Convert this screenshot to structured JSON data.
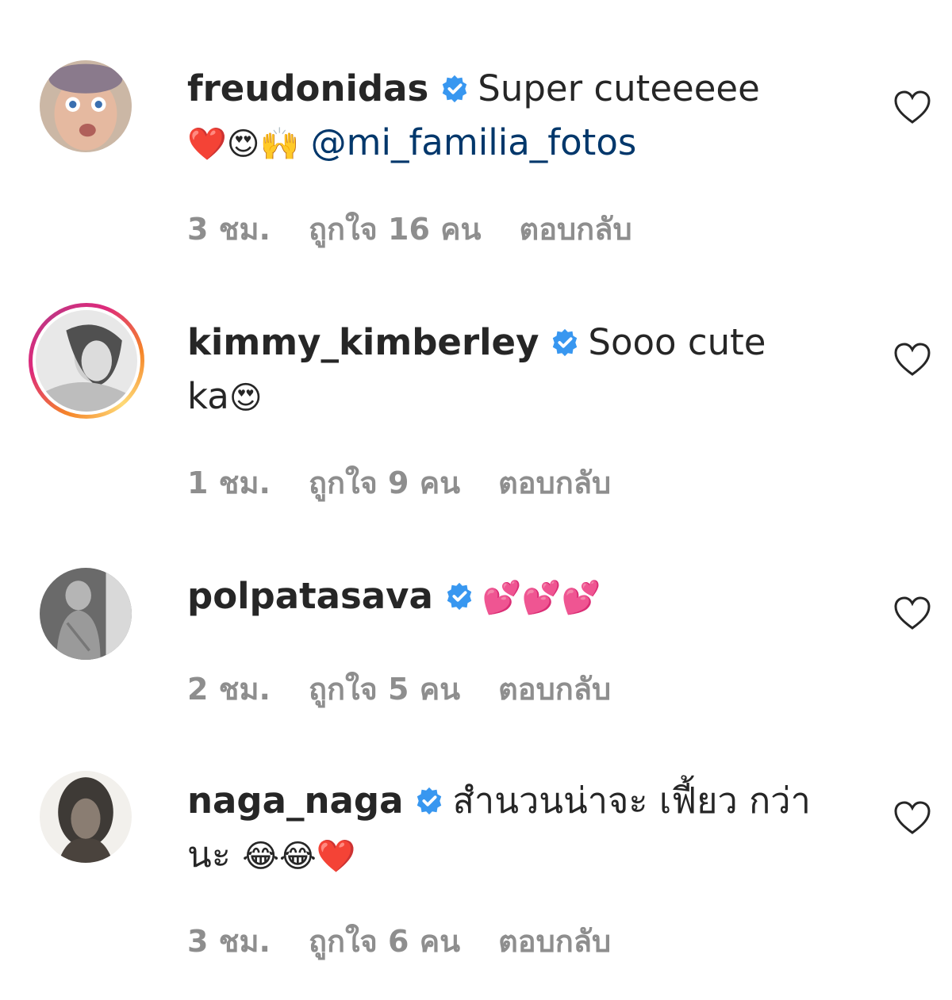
{
  "comments": [
    {
      "username": "freudonidas",
      "text": "Super cuteeeee",
      "emojis": "❤️😍🙌",
      "mention": "@mi_familia_fotos",
      "time": "3 ชม.",
      "likes": "ถูกใจ 16 คน",
      "reply": "ตอบกลับ"
    },
    {
      "username": "kimmy_kimberley",
      "text": "Sooo cute",
      "text2": "ka",
      "emojis": "😍",
      "time": "1 ชม.",
      "likes": "ถูกใจ 9 คน",
      "reply": "ตอบกลับ"
    },
    {
      "username": "polpatasava",
      "emojis": "💕💕💕",
      "time": "2 ชม.",
      "likes": "ถูกใจ 5 คน",
      "reply": "ตอบกลับ"
    },
    {
      "username": "naga_naga",
      "text": "สำนวนน่าจะ เฟี้ยว กว่า",
      "text2": "นะ",
      "emojis": "😂😂❤️",
      "time": "3 ชม.",
      "likes": "ถูกใจ 6 คน",
      "reply": "ตอบกลับ"
    }
  ],
  "colors": {
    "verified": "#3897f0",
    "mention": "#00376b",
    "meta": "#8e8e8e",
    "text": "#262626"
  },
  "icons": {
    "verified": "verified-badge-icon",
    "like": "heart-outline-icon"
  }
}
